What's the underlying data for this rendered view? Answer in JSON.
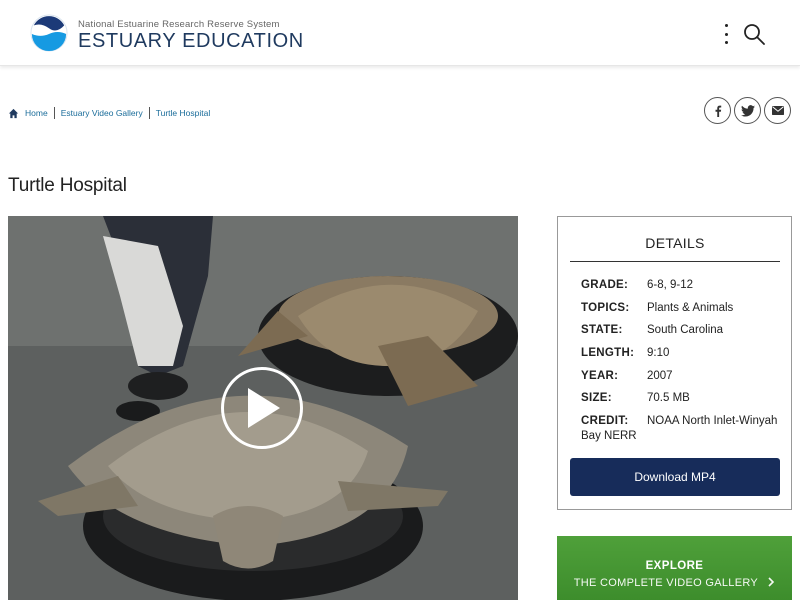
{
  "header": {
    "org_line": "National Estuarine Research Reserve System",
    "site_title": "ESTUARY EDUCATION"
  },
  "breadcrumb": {
    "items": [
      "Home",
      "Estuary Video Gallery",
      "Turtle Hospital"
    ]
  },
  "page": {
    "title": "Turtle Hospital"
  },
  "details": {
    "heading": "DETAILS",
    "rows": [
      {
        "label": "GRADE:",
        "value": "6-8, 9-12"
      },
      {
        "label": "TOPICS:",
        "value": "Plants & Animals"
      },
      {
        "label": "STATE:",
        "value": "South Carolina"
      },
      {
        "label": "LENGTH:",
        "value": "9:10"
      },
      {
        "label": "YEAR:",
        "value": "2007"
      },
      {
        "label": "SIZE:",
        "value": "70.5 MB"
      },
      {
        "label": "CREDIT:",
        "value": "NOAA North Inlet-Winyah Bay NERR"
      }
    ],
    "download_label": "Download MP4"
  },
  "explore": {
    "title": "EXPLORE",
    "subtitle": "THE COMPLETE VIDEO GALLERY"
  },
  "icons": {
    "logo": "noaa-logo-icon",
    "menu": "kebab-menu-icon",
    "search": "search-icon",
    "home": "home-icon",
    "facebook": "facebook-icon",
    "twitter": "twitter-icon",
    "email": "email-icon",
    "play": "play-icon",
    "chevron": "chevron-right-icon"
  },
  "colors": {
    "brand_navy": "#1f3a5f",
    "link_blue": "#1a6c9a",
    "download_bg": "#172c5a",
    "explore_green": "#46962f"
  }
}
